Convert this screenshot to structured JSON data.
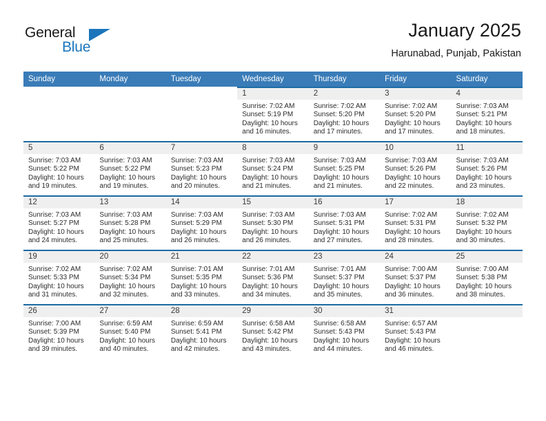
{
  "logo": {
    "word1": "General",
    "word2": "Blue",
    "accent_color": "#1b75bb",
    "triangle_icon": "triangle-icon"
  },
  "header": {
    "title": "January 2025",
    "subtitle": "Harunabad, Punjab, Pakistan"
  },
  "calendar": {
    "header_bg": "#3a7cb8",
    "cell_top_border": "#1b6aa5",
    "daynum_bg": "#efefef",
    "weekdays": [
      "Sunday",
      "Monday",
      "Tuesday",
      "Wednesday",
      "Thursday",
      "Friday",
      "Saturday"
    ],
    "weeks": [
      [
        {
          "day": "",
          "empty": true
        },
        {
          "day": "",
          "empty": true
        },
        {
          "day": "",
          "empty": true
        },
        {
          "day": "1",
          "sunrise": "Sunrise: 7:02 AM",
          "sunset": "Sunset: 5:19 PM",
          "daylight_line1": "Daylight: 10 hours",
          "daylight_line2": "and 16 minutes."
        },
        {
          "day": "2",
          "sunrise": "Sunrise: 7:02 AM",
          "sunset": "Sunset: 5:20 PM",
          "daylight_line1": "Daylight: 10 hours",
          "daylight_line2": "and 17 minutes."
        },
        {
          "day": "3",
          "sunrise": "Sunrise: 7:02 AM",
          "sunset": "Sunset: 5:20 PM",
          "daylight_line1": "Daylight: 10 hours",
          "daylight_line2": "and 17 minutes."
        },
        {
          "day": "4",
          "sunrise": "Sunrise: 7:03 AM",
          "sunset": "Sunset: 5:21 PM",
          "daylight_line1": "Daylight: 10 hours",
          "daylight_line2": "and 18 minutes."
        }
      ],
      [
        {
          "day": "5",
          "sunrise": "Sunrise: 7:03 AM",
          "sunset": "Sunset: 5:22 PM",
          "daylight_line1": "Daylight: 10 hours",
          "daylight_line2": "and 19 minutes."
        },
        {
          "day": "6",
          "sunrise": "Sunrise: 7:03 AM",
          "sunset": "Sunset: 5:22 PM",
          "daylight_line1": "Daylight: 10 hours",
          "daylight_line2": "and 19 minutes."
        },
        {
          "day": "7",
          "sunrise": "Sunrise: 7:03 AM",
          "sunset": "Sunset: 5:23 PM",
          "daylight_line1": "Daylight: 10 hours",
          "daylight_line2": "and 20 minutes."
        },
        {
          "day": "8",
          "sunrise": "Sunrise: 7:03 AM",
          "sunset": "Sunset: 5:24 PM",
          "daylight_line1": "Daylight: 10 hours",
          "daylight_line2": "and 21 minutes."
        },
        {
          "day": "9",
          "sunrise": "Sunrise: 7:03 AM",
          "sunset": "Sunset: 5:25 PM",
          "daylight_line1": "Daylight: 10 hours",
          "daylight_line2": "and 21 minutes."
        },
        {
          "day": "10",
          "sunrise": "Sunrise: 7:03 AM",
          "sunset": "Sunset: 5:26 PM",
          "daylight_line1": "Daylight: 10 hours",
          "daylight_line2": "and 22 minutes."
        },
        {
          "day": "11",
          "sunrise": "Sunrise: 7:03 AM",
          "sunset": "Sunset: 5:26 PM",
          "daylight_line1": "Daylight: 10 hours",
          "daylight_line2": "and 23 minutes."
        }
      ],
      [
        {
          "day": "12",
          "sunrise": "Sunrise: 7:03 AM",
          "sunset": "Sunset: 5:27 PM",
          "daylight_line1": "Daylight: 10 hours",
          "daylight_line2": "and 24 minutes."
        },
        {
          "day": "13",
          "sunrise": "Sunrise: 7:03 AM",
          "sunset": "Sunset: 5:28 PM",
          "daylight_line1": "Daylight: 10 hours",
          "daylight_line2": "and 25 minutes."
        },
        {
          "day": "14",
          "sunrise": "Sunrise: 7:03 AM",
          "sunset": "Sunset: 5:29 PM",
          "daylight_line1": "Daylight: 10 hours",
          "daylight_line2": "and 26 minutes."
        },
        {
          "day": "15",
          "sunrise": "Sunrise: 7:03 AM",
          "sunset": "Sunset: 5:30 PM",
          "daylight_line1": "Daylight: 10 hours",
          "daylight_line2": "and 26 minutes."
        },
        {
          "day": "16",
          "sunrise": "Sunrise: 7:03 AM",
          "sunset": "Sunset: 5:31 PM",
          "daylight_line1": "Daylight: 10 hours",
          "daylight_line2": "and 27 minutes."
        },
        {
          "day": "17",
          "sunrise": "Sunrise: 7:02 AM",
          "sunset": "Sunset: 5:31 PM",
          "daylight_line1": "Daylight: 10 hours",
          "daylight_line2": "and 28 minutes."
        },
        {
          "day": "18",
          "sunrise": "Sunrise: 7:02 AM",
          "sunset": "Sunset: 5:32 PM",
          "daylight_line1": "Daylight: 10 hours",
          "daylight_line2": "and 30 minutes."
        }
      ],
      [
        {
          "day": "19",
          "sunrise": "Sunrise: 7:02 AM",
          "sunset": "Sunset: 5:33 PM",
          "daylight_line1": "Daylight: 10 hours",
          "daylight_line2": "and 31 minutes."
        },
        {
          "day": "20",
          "sunrise": "Sunrise: 7:02 AM",
          "sunset": "Sunset: 5:34 PM",
          "daylight_line1": "Daylight: 10 hours",
          "daylight_line2": "and 32 minutes."
        },
        {
          "day": "21",
          "sunrise": "Sunrise: 7:01 AM",
          "sunset": "Sunset: 5:35 PM",
          "daylight_line1": "Daylight: 10 hours",
          "daylight_line2": "and 33 minutes."
        },
        {
          "day": "22",
          "sunrise": "Sunrise: 7:01 AM",
          "sunset": "Sunset: 5:36 PM",
          "daylight_line1": "Daylight: 10 hours",
          "daylight_line2": "and 34 minutes."
        },
        {
          "day": "23",
          "sunrise": "Sunrise: 7:01 AM",
          "sunset": "Sunset: 5:37 PM",
          "daylight_line1": "Daylight: 10 hours",
          "daylight_line2": "and 35 minutes."
        },
        {
          "day": "24",
          "sunrise": "Sunrise: 7:00 AM",
          "sunset": "Sunset: 5:37 PM",
          "daylight_line1": "Daylight: 10 hours",
          "daylight_line2": "and 36 minutes."
        },
        {
          "day": "25",
          "sunrise": "Sunrise: 7:00 AM",
          "sunset": "Sunset: 5:38 PM",
          "daylight_line1": "Daylight: 10 hours",
          "daylight_line2": "and 38 minutes."
        }
      ],
      [
        {
          "day": "26",
          "sunrise": "Sunrise: 7:00 AM",
          "sunset": "Sunset: 5:39 PM",
          "daylight_line1": "Daylight: 10 hours",
          "daylight_line2": "and 39 minutes."
        },
        {
          "day": "27",
          "sunrise": "Sunrise: 6:59 AM",
          "sunset": "Sunset: 5:40 PM",
          "daylight_line1": "Daylight: 10 hours",
          "daylight_line2": "and 40 minutes."
        },
        {
          "day": "28",
          "sunrise": "Sunrise: 6:59 AM",
          "sunset": "Sunset: 5:41 PM",
          "daylight_line1": "Daylight: 10 hours",
          "daylight_line2": "and 42 minutes."
        },
        {
          "day": "29",
          "sunrise": "Sunrise: 6:58 AM",
          "sunset": "Sunset: 5:42 PM",
          "daylight_line1": "Daylight: 10 hours",
          "daylight_line2": "and 43 minutes."
        },
        {
          "day": "30",
          "sunrise": "Sunrise: 6:58 AM",
          "sunset": "Sunset: 5:43 PM",
          "daylight_line1": "Daylight: 10 hours",
          "daylight_line2": "and 44 minutes."
        },
        {
          "day": "31",
          "sunrise": "Sunrise: 6:57 AM",
          "sunset": "Sunset: 5:43 PM",
          "daylight_line1": "Daylight: 10 hours",
          "daylight_line2": "and 46 minutes."
        },
        {
          "day": "",
          "empty": true
        }
      ]
    ]
  }
}
